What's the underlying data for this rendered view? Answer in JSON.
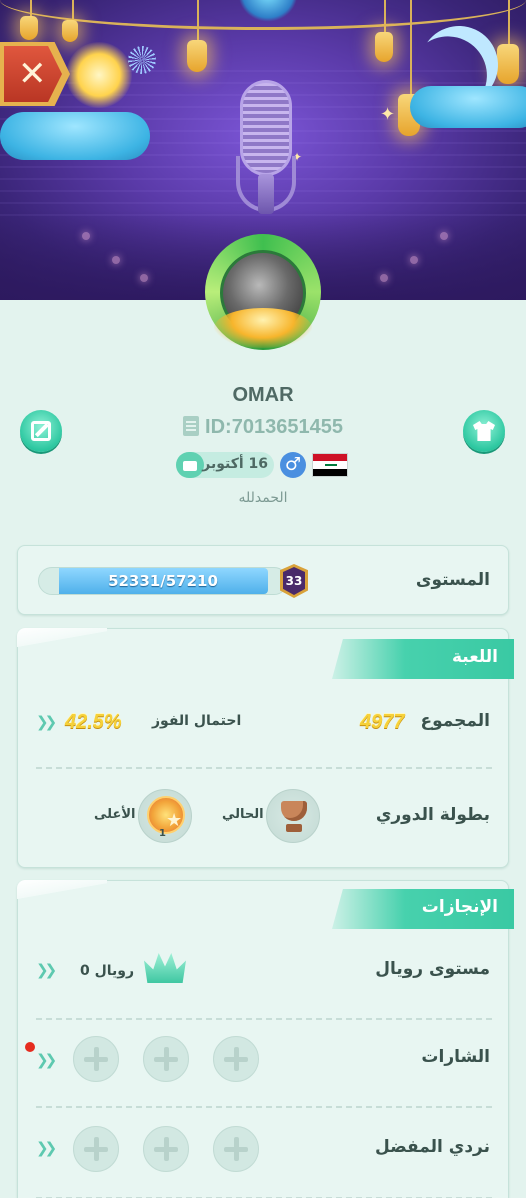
{
  "profile": {
    "username": "OMAR",
    "id": "ID:7013651455",
    "birthday": "16 أكتوبر",
    "bio": "الحمدلله",
    "gender_icon": "male-icon",
    "flag": "iraq-flag"
  },
  "level": {
    "label": "المستوى",
    "progress_text": "52331/57210",
    "current_xp": 52331,
    "next_xp": 57210,
    "level_number": "33"
  },
  "game_section": {
    "title": "اللعبة",
    "total_label": "المجموع",
    "total_value": "4977",
    "win_rate_label": "احتمال الفوز",
    "win_rate_value": "42.5%",
    "league_label": "بطولة الدوري",
    "current_label": "الحالي",
    "highest_label": "الأعلى",
    "highest_rank": "1"
  },
  "achievements_section": {
    "title": "الإنجازات",
    "royal_level_label": "مستوى رويال",
    "royal_value": "رويال 0",
    "badges_label": "الشارات",
    "favorite_dice_label": "نردي المفضل"
  },
  "colors": {
    "accent": "#2cc7a0",
    "gold": "#f6d13a",
    "progress": "#4fb0ea",
    "notification": "#e52c1f"
  }
}
